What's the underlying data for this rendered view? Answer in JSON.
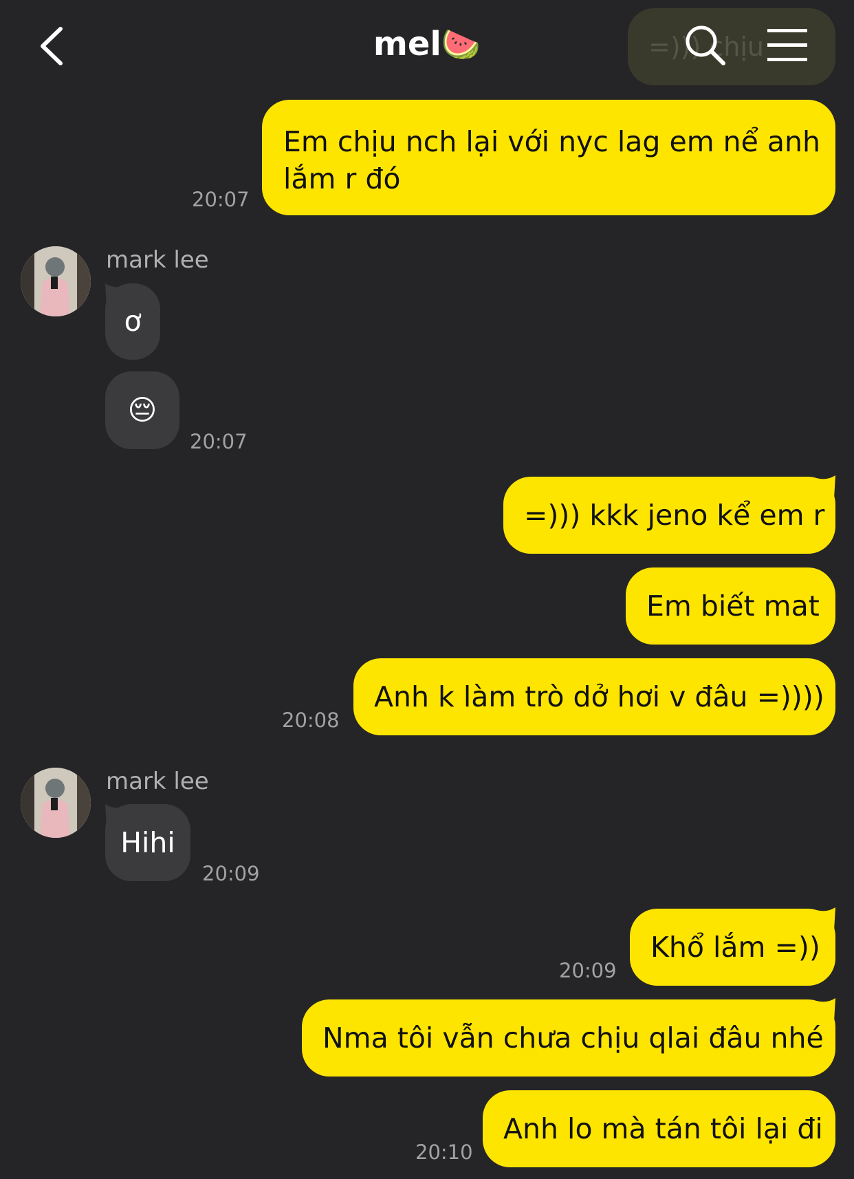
{
  "header": {
    "title": "mel",
    "title_emoji": "🍉",
    "back_icon": "chevron-left-icon",
    "search_icon": "search-icon",
    "menu_icon": "hamburger-menu-icon",
    "ghost_preview": "=))) chịu"
  },
  "colors": {
    "background": "#252527",
    "outgoing": "#fee500",
    "incoming": "#3b3b3d",
    "timestamp": "#a2a2a6"
  },
  "messages": [
    {
      "dir": "out",
      "text_line1": "Em chịu nch lại với nyc lag em nể anh",
      "text_line2": "lắm r đó",
      "time": "20:07"
    },
    {
      "dir": "in",
      "sender": "mark lee",
      "text": "ơ"
    },
    {
      "dir": "in",
      "text": "😔",
      "time": "20:07"
    },
    {
      "dir": "out",
      "text": "=))) kkk jeno kể em r"
    },
    {
      "dir": "out",
      "text": "Em biết mat"
    },
    {
      "dir": "out",
      "text": "Anh k làm trò dở hơi v đâu =))))",
      "time": "20:08"
    },
    {
      "dir": "in",
      "sender": "mark lee",
      "text": "Hihi",
      "time": "20:09"
    },
    {
      "dir": "out",
      "text": "Khổ lắm =))",
      "time": "20:09"
    },
    {
      "dir": "out",
      "text": "Nma tôi vẫn chưa chịu qlai đâu nhé"
    },
    {
      "dir": "out",
      "text": "Anh lo mà tán tôi lại đi",
      "time": "20:10"
    }
  ]
}
